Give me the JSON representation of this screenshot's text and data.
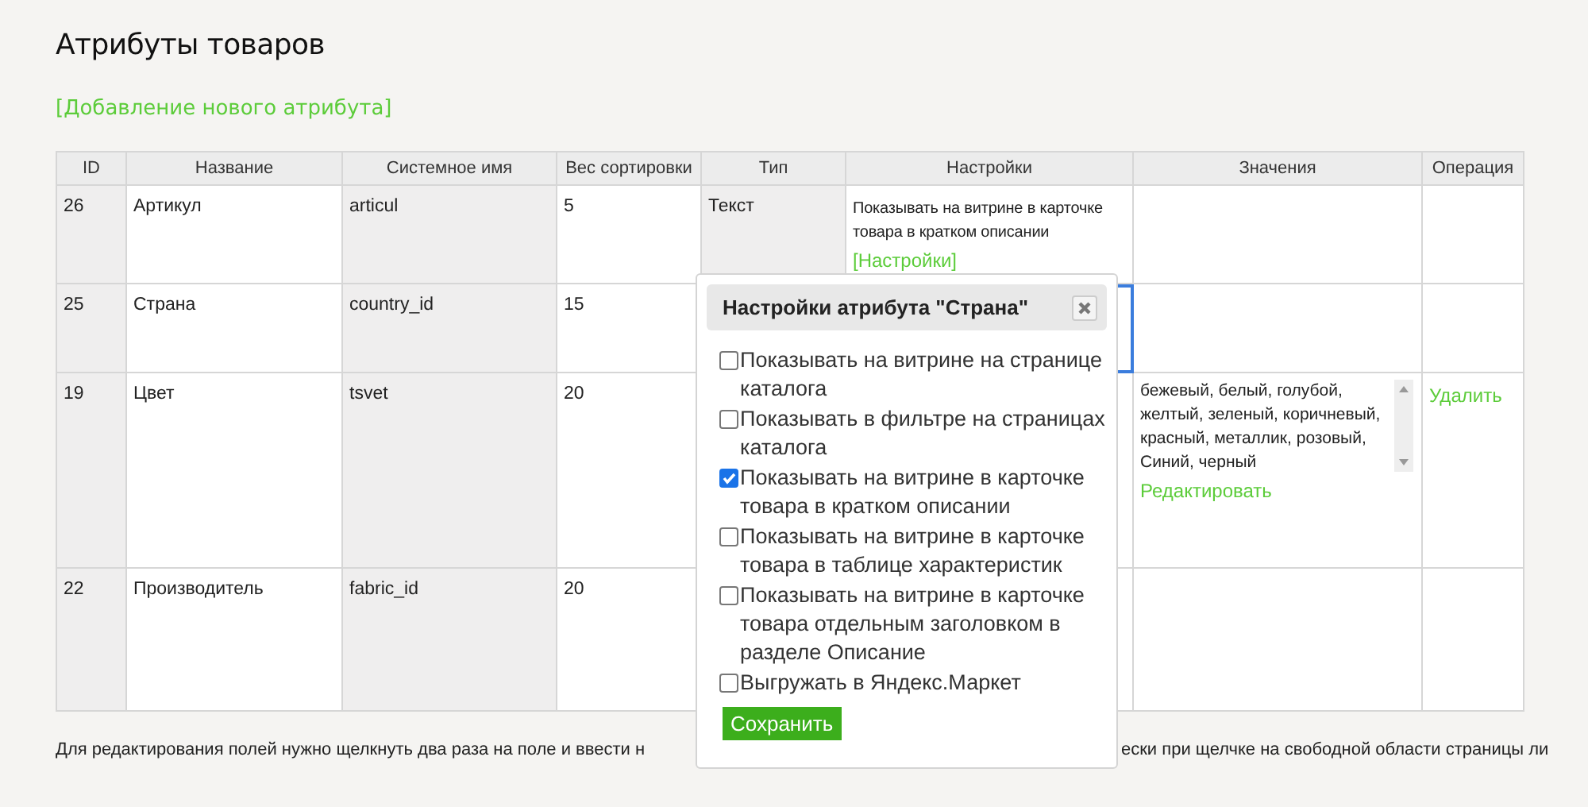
{
  "title": "Атрибуты товаров",
  "add_link": "[Добавление нового атрибута]",
  "table": {
    "columns": [
      "ID",
      "Название",
      "Системное имя",
      "Вес сортировки",
      "Тип",
      "Настройки",
      "Значения",
      "Операция"
    ],
    "rows": [
      {
        "id": "26",
        "name": "Артикул",
        "system_name": "articul",
        "sort_weight": "5",
        "type": "Текст",
        "settings": {
          "text": "Показывать на витрине в карточке товара в кратком описании",
          "link": "[Настройки]",
          "editing": false
        }
      },
      {
        "id": "25",
        "name": "Страна",
        "system_name": "country_id",
        "sort_weight": "15",
        "settings": {
          "editing": true
        }
      },
      {
        "id": "19",
        "name": "Цвет",
        "system_name": "tsvet",
        "sort_weight": "20",
        "settings": {
          "editing": false
        },
        "values": {
          "lines": [
            "бежевый, белый, голубой,",
            "желтый, зеленый, коричневый,",
            "красный, металлик, розовый,",
            "Синий, черный"
          ],
          "link": "Редактировать"
        },
        "operation": "Удалить"
      },
      {
        "id": "22",
        "name": "Производитель",
        "system_name": "fabric_id",
        "sort_weight": "20",
        "settings": {
          "editing": false
        }
      }
    ]
  },
  "dialog": {
    "title": "Настройки атрибута \"Страна\"",
    "options": [
      {
        "label": "Показывать на витрине на странице каталога",
        "checked": false
      },
      {
        "label": "Показывать в фильтре на страницах каталога",
        "checked": false
      },
      {
        "label": "Показывать на витрине в карточке товара в кратком описании",
        "checked": true
      },
      {
        "label": "Показывать на витрине в карточке товара в таблице характеристик",
        "checked": false
      },
      {
        "label": "Показывать на витрине в карточке товара отдельным заголовком в разделе Описание",
        "checked": false
      },
      {
        "label": "Выгружать в Яндекс.Маркет",
        "checked": false
      }
    ],
    "save": "Сохранить"
  },
  "footer": {
    "left": "Для редактирования полей нужно щелкнуть два раза на поле и ввести н",
    "right": "ески при щелчке на свободной области страницы ли"
  }
}
